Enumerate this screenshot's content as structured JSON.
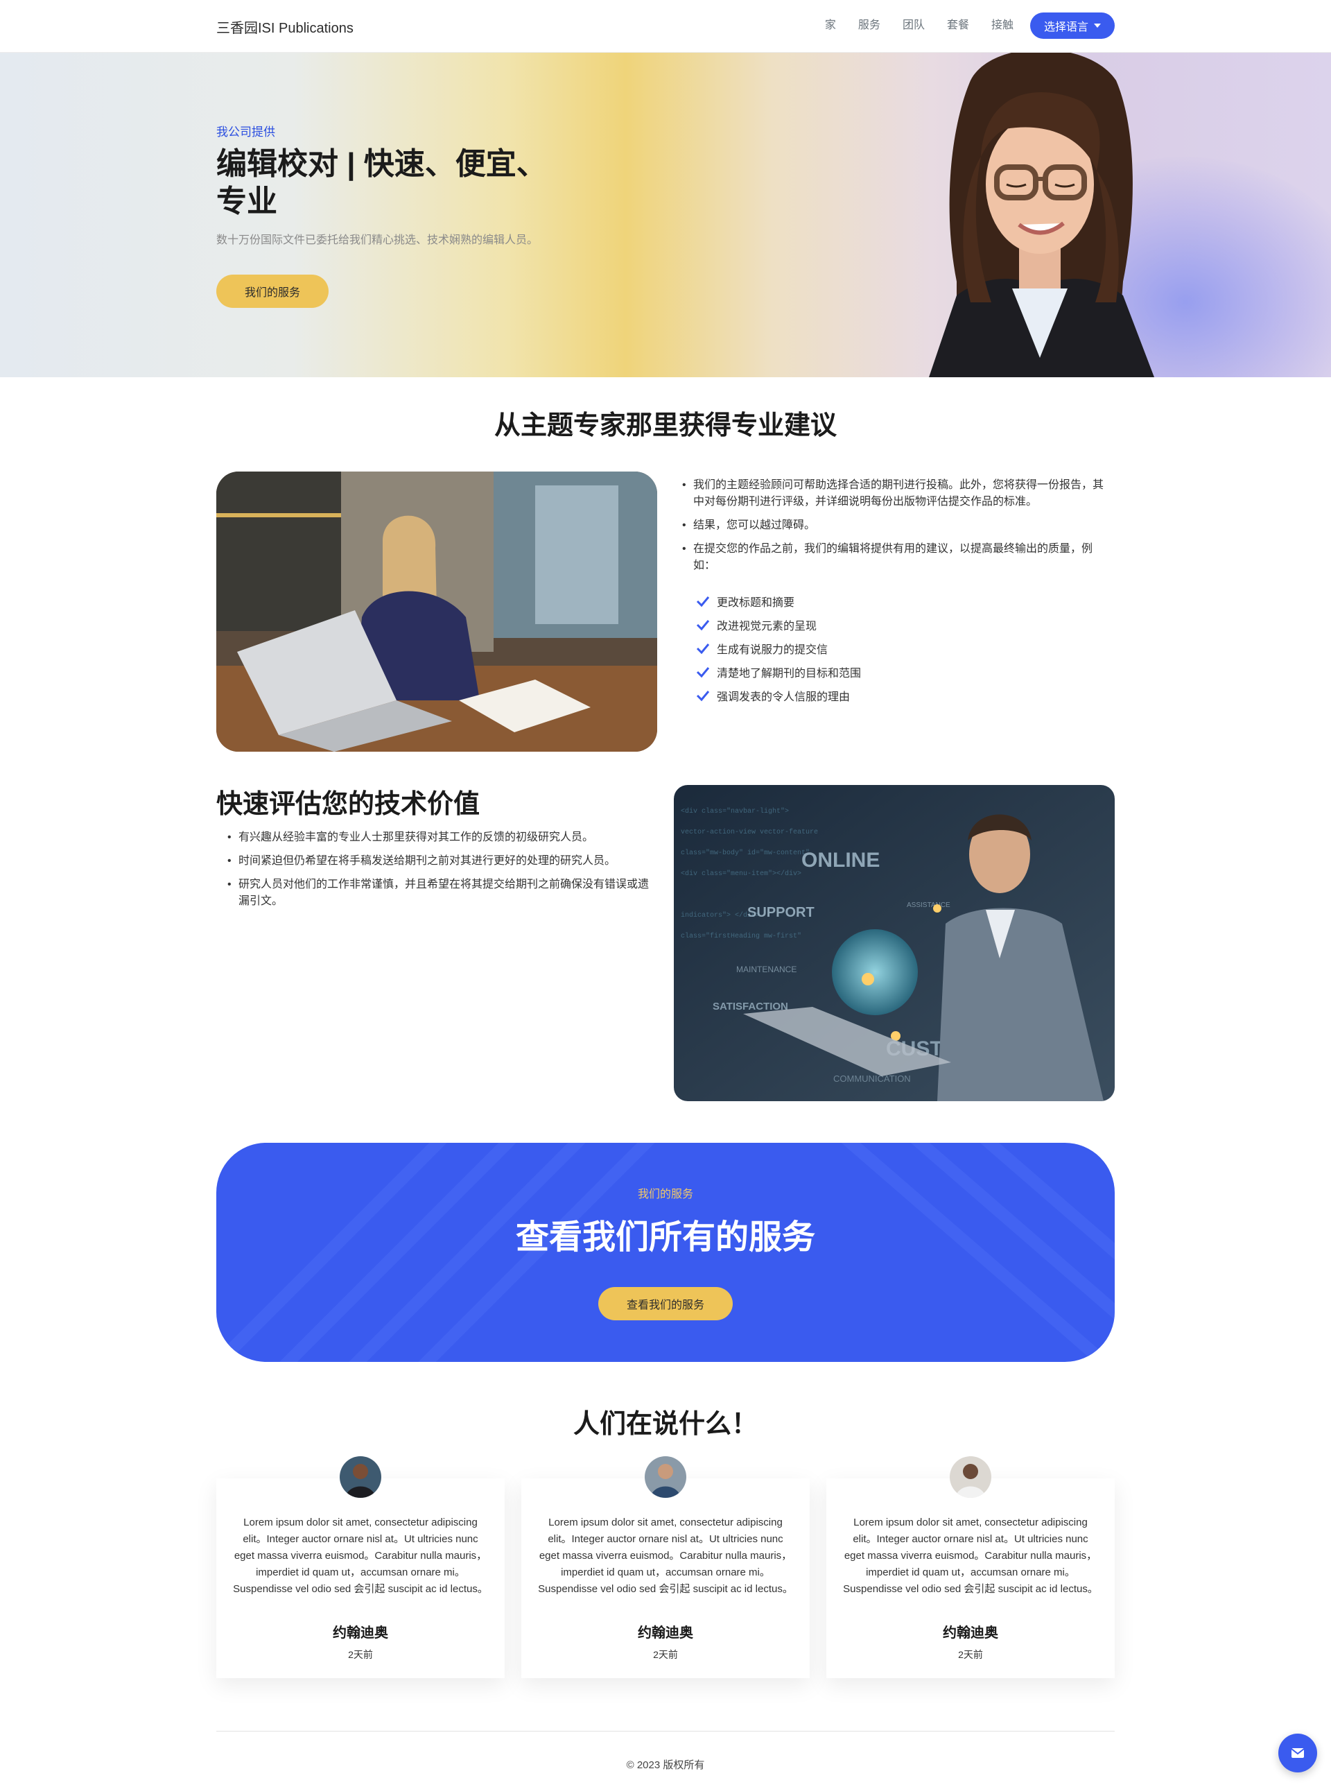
{
  "nav": {
    "brand": "三香园ISI Publications",
    "items": [
      "家",
      "服务",
      "团队",
      "套餐",
      "接触"
    ],
    "language_button": "选择语言"
  },
  "hero": {
    "kicker": "我公司提供",
    "title": "编辑校对 | 快速、便宜、专业",
    "subtitle": "数十万份国际文件已委托给我们精心挑选、技术娴熟的编辑人员。",
    "button": "我们的服务"
  },
  "expert": {
    "title": "从主题专家那里获得专业建议",
    "bullets": [
      "我们的主题经验顾问可帮助选择合适的期刊进行投稿。此外，您将获得一份报告，其中对每份期刊进行评级，并详细说明每份出版物评估提交作品的标准。",
      "结果，您可以越过障碍。",
      "在提交您的作品之前，我们的编辑将提供有用的建议，以提高最终输出的质量，例如："
    ],
    "checks": [
      "更改标题和摘要",
      "改进视觉元素的呈现",
      "生成有说服力的提交信",
      "清楚地了解期刊的目标和范围",
      "强调发表的令人信服的理由"
    ]
  },
  "assess": {
    "title": "快速评估您的技术价值",
    "bullets": [
      "有兴趣从经验丰富的专业人士那里获得对其工作的反馈的初级研究人员。",
      "时间紧迫但仍希望在将手稿发送给期刊之前对其进行更好的处理的研究人员。",
      "研究人员对他们的工作非常谨慎，并且希望在将其提交给期刊之前确保没有错误或遗漏引文。"
    ],
    "image_words": [
      "ONLINE",
      "SUPPORT",
      "MAINTENANCE",
      "SATISFACTION",
      "CUSTOMER",
      "COMMUNICATION",
      "ASSISTANCE"
    ]
  },
  "cta": {
    "kicker": "我们的服务",
    "title": "查看我们所有的服务",
    "button": "查看我们的服务"
  },
  "testimonials": {
    "title": "人们在说什么！",
    "cards": [
      {
        "text": "Lorem ipsum dolor sit amet, consectetur adipiscing elit。Integer auctor ornare nisl at。Ut ultricies nunc eget massa viverra euismod。Carabitur nulla mauris，imperdiet id quam ut，accumsan ornare mi。Suspendisse vel odio sed 会引起 suscipit ac id lectus。",
        "name": "约翰迪奥",
        "time": "2天前"
      },
      {
        "text": "Lorem ipsum dolor sit amet, consectetur adipiscing elit。Integer auctor ornare nisl at。Ut ultricies nunc eget massa viverra euismod。Carabitur nulla mauris，imperdiet id quam ut，accumsan ornare mi。Suspendisse vel odio sed 会引起 suscipit ac id lectus。",
        "name": "约翰迪奥",
        "time": "2天前"
      },
      {
        "text": "Lorem ipsum dolor sit amet, consectetur adipiscing elit。Integer auctor ornare nisl at。Ut ultricies nunc eget massa viverra euismod。Carabitur nulla mauris，imperdiet id quam ut，accumsan ornare mi。Suspendisse vel odio sed 会引起 suscipit ac id lectus。",
        "name": "约翰迪奥",
        "time": "2天前"
      }
    ]
  },
  "footer": {
    "copyright": "© 2023 版权所有"
  },
  "colors": {
    "accent": "#3a5bef",
    "button_yellow": "#eec458",
    "kicker_blue": "#2b4fe0"
  },
  "icons": {
    "chat": "envelope-icon",
    "check": "check-icon"
  }
}
